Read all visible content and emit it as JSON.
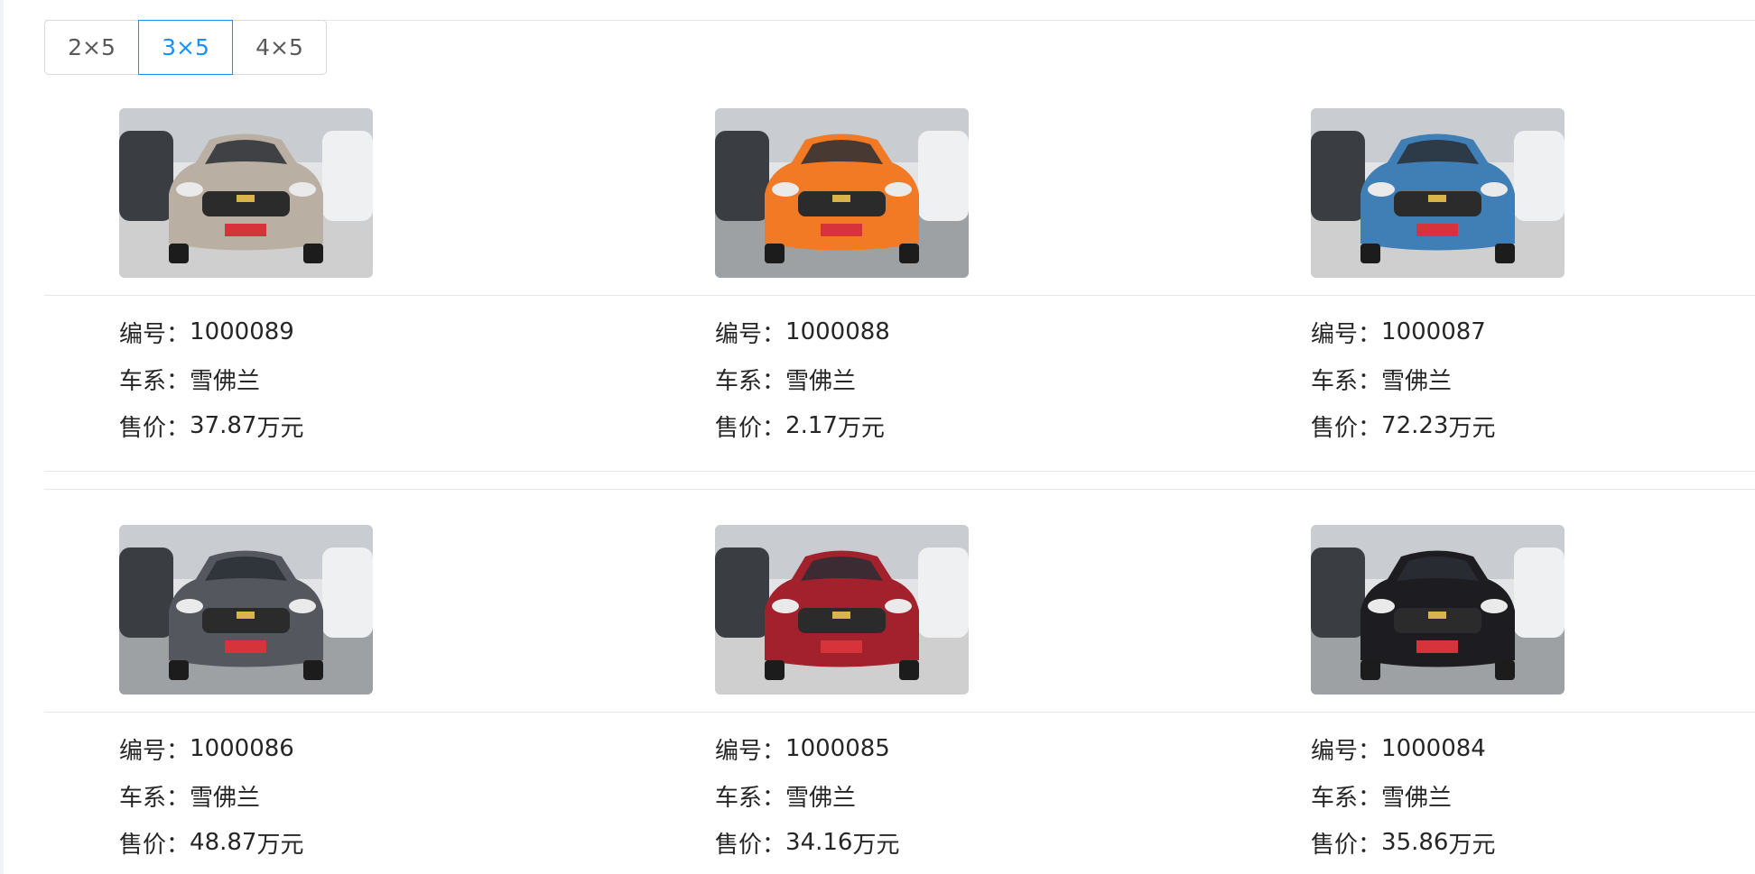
{
  "layout_switcher": {
    "options": [
      "2×5",
      "3×5",
      "4×5"
    ],
    "selected": "3×5"
  },
  "labels": {
    "id": "编号",
    "series": "车系",
    "price": "售价",
    "colon": "：",
    "price_unit": "万元"
  },
  "cars": [
    {
      "id": "1000089",
      "series": "雪佛兰",
      "price": "37.87",
      "body_color": "#b9b0a3"
    },
    {
      "id": "1000088",
      "series": "雪佛兰",
      "price": "2.17",
      "body_color": "#f27a25"
    },
    {
      "id": "1000087",
      "series": "雪佛兰",
      "price": "72.23",
      "body_color": "#3f7fb6"
    },
    {
      "id": "1000086",
      "series": "雪佛兰",
      "price": "48.87",
      "body_color": "#55575f"
    },
    {
      "id": "1000085",
      "series": "雪佛兰",
      "price": "34.16",
      "body_color": "#a3202d"
    },
    {
      "id": "1000084",
      "series": "雪佛兰",
      "price": "35.86",
      "body_color": "#1d1d21"
    }
  ],
  "colors": {
    "accent": "#1890ff",
    "border": "#d9d9d9",
    "divider": "#e8e8e8",
    "text": "#262626"
  }
}
